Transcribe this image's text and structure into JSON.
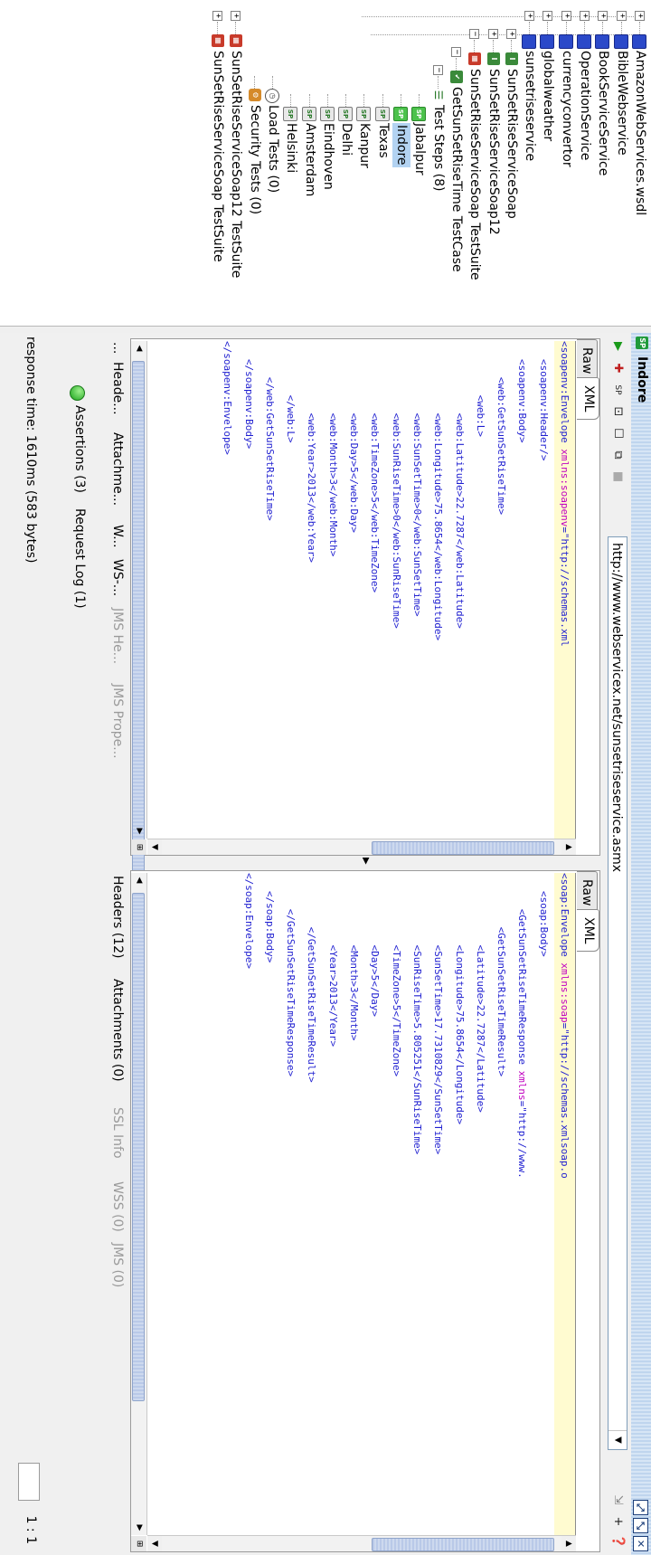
{
  "tree": {
    "interfaces": [
      "AmazonWebServices.wsdl",
      "BibleWebservice",
      "BookServiceService",
      "OperationService",
      "currencyconvertor",
      "globalweather",
      "sunsetriseservice"
    ],
    "soap_interfaces": [
      "SunSetRiseServiceSoap",
      "SunSetRiseServiceSoap12"
    ],
    "suite": "SunSetRiseServiceSoap TestSuite",
    "testcase": "GetSunSetRiseTime TestCase",
    "test_steps": "Test Steps (8)",
    "steps": [
      "Jabalpur",
      "Indore",
      "Texas",
      "Kanpur",
      "Delhi",
      "Eindhoven",
      "Amsterdam",
      "Helsinki"
    ],
    "selected_step": "Indore",
    "load_tests": "Load Tests (0)",
    "security_tests": "Security Tests (0)",
    "other_suites": [
      "SunSetRiseServiceSoap12 TestSuite",
      "SunSetRiseServiceSoap TestSuite"
    ]
  },
  "window": {
    "title": "Indore",
    "endpoint": "http://www.webservicex.net/sunsetriseservice.asmx"
  },
  "request": {
    "tabs": [
      "Raw",
      "XML"
    ],
    "active_tab": "XML",
    "xml_lines": [
      {
        "indent": 0,
        "pre": "<soapenv:Envelope ",
        "attr": "xmlns:soapenv",
        "post": "=\"http://schemas.xml"
      },
      {
        "indent": 3,
        "text": "<soapenv:Header/>"
      },
      {
        "indent": 3,
        "text": "<soapenv:Body>"
      },
      {
        "indent": 6,
        "text": "<web:GetSunSetRiseTime>"
      },
      {
        "indent": 9,
        "text": "<web:L>"
      },
      {
        "indent": 12,
        "text": "<web:Latitude>22.7287</web:Latitude>"
      },
      {
        "indent": 12,
        "text": "<web:Longitude>75.8654</web:Longitude>"
      },
      {
        "indent": 12,
        "text": "<web:SunSetTime>0</web:SunSetTime>"
      },
      {
        "indent": 12,
        "text": "<web:SunRiseTime>0</web:SunRiseTime>"
      },
      {
        "indent": 12,
        "text": "<web:TimeZone>5</web:TimeZone>"
      },
      {
        "indent": 12,
        "text": "<web:Day>5</web:Day>"
      },
      {
        "indent": 12,
        "text": "<web:Month>3</web:Month>"
      },
      {
        "indent": 12,
        "text": "<web:Year>2013</web:Year>"
      },
      {
        "indent": 9,
        "text": "</web:L>"
      },
      {
        "indent": 6,
        "text": "</web:GetSunSetRiseTime>"
      },
      {
        "indent": 3,
        "text": "</soapenv:Body>"
      },
      {
        "indent": 0,
        "text": "</soapenv:Envelope>"
      }
    ],
    "bottom_tabs": [
      "...",
      "Heade...",
      "Attachme...",
      "W...",
      "WS-...",
      "JMS He...",
      "JMS Prope..."
    ]
  },
  "response": {
    "tabs": [
      "Raw",
      "XML"
    ],
    "active_tab": "XML",
    "xml_lines": [
      {
        "indent": 0,
        "pre": "<soap:Envelope ",
        "attr": "xmlns:soap",
        "post": "=\"http://schemas.xmlsoap.o"
      },
      {
        "indent": 3,
        "text": "<soap:Body>"
      },
      {
        "indent": 6,
        "pre": "<GetSunSetRiseTimeResponse ",
        "attr": "xmlns",
        "post": "=\"http://www."
      },
      {
        "indent": 9,
        "text": "<GetSunSetRiseTimeResult>"
      },
      {
        "indent": 12,
        "text": "<Latitude>22.7287</Latitude>"
      },
      {
        "indent": 12,
        "text": "<Longitude>75.8654</Longitude>"
      },
      {
        "indent": 12,
        "text": "<SunSetTime>17.7310829</SunSetTime>"
      },
      {
        "indent": 12,
        "text": "<SunRiseTime>5.805251</SunRiseTime>"
      },
      {
        "indent": 12,
        "text": "<TimeZone>5</TimeZone>"
      },
      {
        "indent": 12,
        "text": "<Day>5</Day>"
      },
      {
        "indent": 12,
        "text": "<Month>3</Month>"
      },
      {
        "indent": 12,
        "text": "<Year>2013</Year>"
      },
      {
        "indent": 9,
        "text": "</GetSunSetRiseTimeResult>"
      },
      {
        "indent": 6,
        "text": "</GetSunSetRiseTimeResponse>"
      },
      {
        "indent": 3,
        "text": "</soap:Body>"
      },
      {
        "indent": 0,
        "text": "</soap:Envelope>"
      }
    ],
    "bottom_tabs": [
      "Headers (12)",
      "Attachments (0)",
      "SSL Info",
      "WSS (0)",
      "JMS (0)"
    ]
  },
  "assertions": {
    "label": "Assertions (3)",
    "request_log": "Request Log (1)"
  },
  "status": {
    "response_time": "response time: 1610ms (583 bytes)",
    "zoom": "1 : 1"
  },
  "colors": {
    "xml_text": "#1f1fd0",
    "xml_attr": "#c000c0",
    "selection": "#b3d3f2",
    "title_bar": "#c6dbf1"
  }
}
